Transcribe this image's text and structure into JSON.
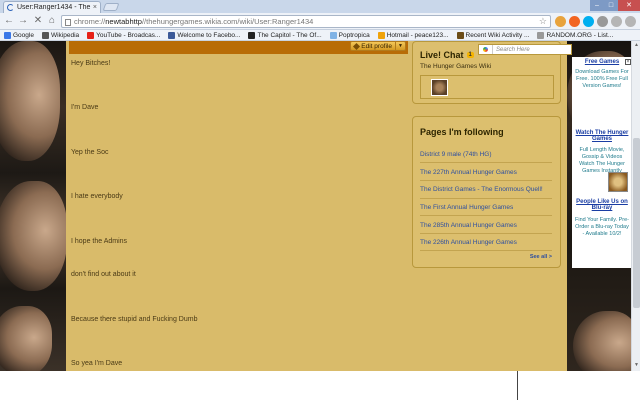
{
  "browser": {
    "tab_title": "User:Ranger1434 - The Hu",
    "tab_close": "×",
    "url_scheme": "chrome://",
    "url_host": "newtabhttp",
    "url_path": "//thehungergames.wikia.com/wiki/User:Ranger1434",
    "bookmarks": [
      {
        "label": "Google",
        "color": "#3b78e7"
      },
      {
        "label": "Wikipedia",
        "color": "#555555"
      },
      {
        "label": "YouTube - Broadcas...",
        "color": "#e62117"
      },
      {
        "label": "Welcome to Facebo...",
        "color": "#3b5998"
      },
      {
        "label": "The Capitol - The Of...",
        "color": "#222222"
      },
      {
        "label": "Poptropica",
        "color": "#7fb2e5"
      },
      {
        "label": "Hotmail - peace123...",
        "color": "#f0a30a"
      },
      {
        "label": "Recent Wiki Activity ...",
        "color": "#6b4c16"
      },
      {
        "label": "RANDOM.ORG - List...",
        "color": "#999999"
      }
    ]
  },
  "profile": {
    "edit_label": "Edit profile",
    "post_lines": [
      "Hey Bitches!",
      "I'm Dave",
      "Yep the Soc",
      "I hate everybody",
      "I hope the Admins",
      "don't find out about it",
      "Because there stupid and Fucking Dumb",
      "So yea I'm Dave"
    ]
  },
  "sidebar": {
    "search_placeholder": "Search Here",
    "chat_title": "Live! Chat",
    "chat_count": "1",
    "chat_wiki": "The Hunger Games Wiki",
    "following_title": "Pages I'm following",
    "following": [
      "District 9 male (74th HG)",
      "The 227th Annual Hunger Games",
      "The District Games - The Enormous Quell!",
      "The First Annual Hunger Games",
      "The 285th Annual Hunger Games",
      "The 226th Annual Hunger Games"
    ],
    "see_all": "See all >"
  },
  "ads": [
    {
      "title": "Free Games",
      "text": "Download Games For Free. 100% Free Full Version Games!"
    },
    {
      "title": "Watch The Hunger Games",
      "text": "Full Length Movie, Gossip & Videos Watch The Hunger Games Instantly"
    },
    {
      "title": "People Like Us on Blu-ray",
      "text": "Find Your Family. Pre-Order a Blu-ray Today - Available 10/2!"
    }
  ],
  "colors": {
    "accent_orange": "#b86c06",
    "page_tan": "#d9bb6a",
    "link_blue": "#2e4fa0"
  }
}
